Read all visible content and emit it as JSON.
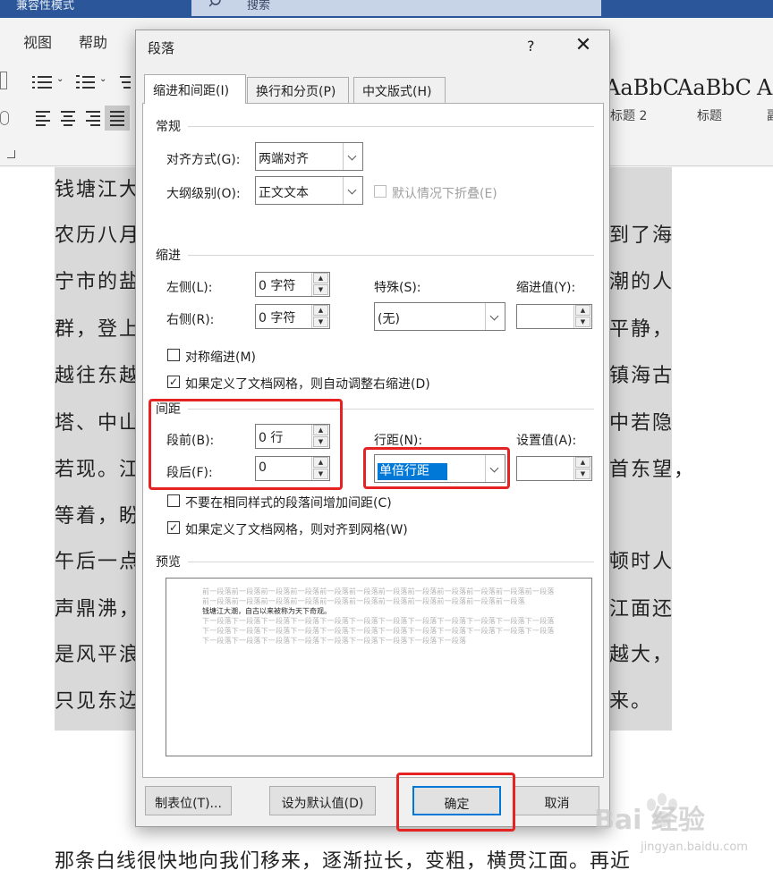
{
  "app": {
    "mode_title": "兼容性模式",
    "search_placeholder": "搜索",
    "menu": [
      "视图",
      "帮助"
    ],
    "styles": [
      {
        "sample": "AaBbC",
        "label": "标题 2"
      },
      {
        "sample": "AaBbC",
        "label": "标题"
      },
      {
        "sample": "A",
        "label": "副"
      }
    ]
  },
  "document": {
    "lines": [
      "钱塘江大",
      "农历八月",
      "宁市的盐",
      "群，登上",
      "越往东越",
      "塔、中山",
      "若现。江",
      "等着，盼",
      "午后一点",
      "声鼎沸，",
      "是风平浪",
      "只见东边",
      "那条白线很快地向我们移来，逐渐拉长，变粗，横贯江面。再近"
    ],
    "right_fragments": [
      "到了海",
      "潮的人",
      "平静，",
      "镇海古",
      "中若隐",
      "首东望，",
      "顿时人",
      "江面还",
      "越大，",
      "来。"
    ]
  },
  "dialog": {
    "title": "段落",
    "help": "?",
    "close": "✕",
    "tabs": [
      "缩进和间距(I)",
      "换行和分页(P)",
      "中文版式(H)"
    ],
    "general": {
      "heading": "常规",
      "alignment_label": "对齐方式(G):",
      "alignment_value": "两端对齐",
      "outline_label": "大纲级别(O):",
      "outline_value": "正文文本",
      "collapse_label": "默认情况下折叠(E)"
    },
    "indent": {
      "heading": "缩进",
      "left_label": "左侧(L):",
      "left_value": "0 字符",
      "right_label": "右侧(R):",
      "right_value": "0 字符",
      "special_label": "特殊(S):",
      "special_value": "(无)",
      "indent_by_label": "缩进值(Y):",
      "indent_by_value": "",
      "mirror_label": "对称缩进(M)",
      "mirror_checked": false,
      "auto_adjust_label": "如果定义了文档网格，则自动调整右缩进(D)",
      "auto_adjust_checked": true
    },
    "spacing": {
      "heading": "间距",
      "before_label": "段前(B):",
      "before_value": "0 行",
      "after_label": "段后(F):",
      "after_value": "0",
      "line_label": "行距(N):",
      "line_value": "单倍行距",
      "at_label": "设置值(A):",
      "at_value": "",
      "no_space_label": "不要在相同样式的段落间增加间距(C)",
      "no_space_checked": false,
      "snap_grid_label": "如果定义了文档网格，则对齐到网格(W)",
      "snap_grid_checked": true
    },
    "preview": {
      "heading": "预览",
      "prev_text": "前一段落前一段落前一段落前一段落前一段落前一段落前一段落前一段落前一段落前一段落前一段落前一段落前一段落前一段落前一段落前一段落前一段落前一段落前一段落前一段落前一段落前一段落前一段落",
      "current_text": "钱塘江大潮，自古以来被称为天下奇观。",
      "next_text": "下一段落下一段落下一段落下一段落下一段落下一段落下一段落下一段落下一段落下一段落下一段落下一段落下一段落下一段落下一段落下一段落下一段落下一段落下一段落下一段落下一段落下一段落下一段落下一段落下一段落下一段落下一段落下一段落下一段落下一段落下一段落下一段落下一段落"
    },
    "buttons": {
      "tabs": "制表位(T)...",
      "set_default": "设为默认值(D)",
      "ok": "确定",
      "cancel": "取消"
    }
  },
  "watermark": {
    "text": "Bai 经验",
    "sub": "jingyan.baidu.com"
  }
}
